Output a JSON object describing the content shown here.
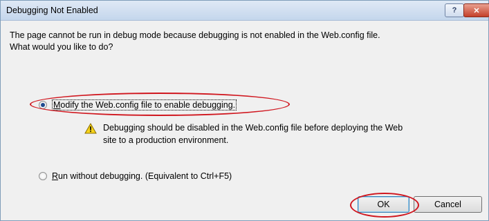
{
  "dialog": {
    "title": "Debugging Not Enabled",
    "help_glyph": "?",
    "close_glyph": "✕",
    "message_line1": "The page cannot be run in debug mode because debugging is not enabled in the Web.config file.",
    "message_line2": "What would you like to do?",
    "option_modify": {
      "accel": "M",
      "label_rest": "odify the Web.config file to enable debugging.",
      "selected": true
    },
    "warning": {
      "icon": "warning-icon",
      "line1": "Debugging should be disabled in the Web.config file before deploying the Web",
      "line2": "site to a production environment."
    },
    "option_run": {
      "accel": "R",
      "label_rest": "un without debugging. (Equivalent to Ctrl+F5)",
      "selected": false
    },
    "ok_label": "OK",
    "cancel_label": "Cancel",
    "highlight_color": "#d0161e"
  }
}
